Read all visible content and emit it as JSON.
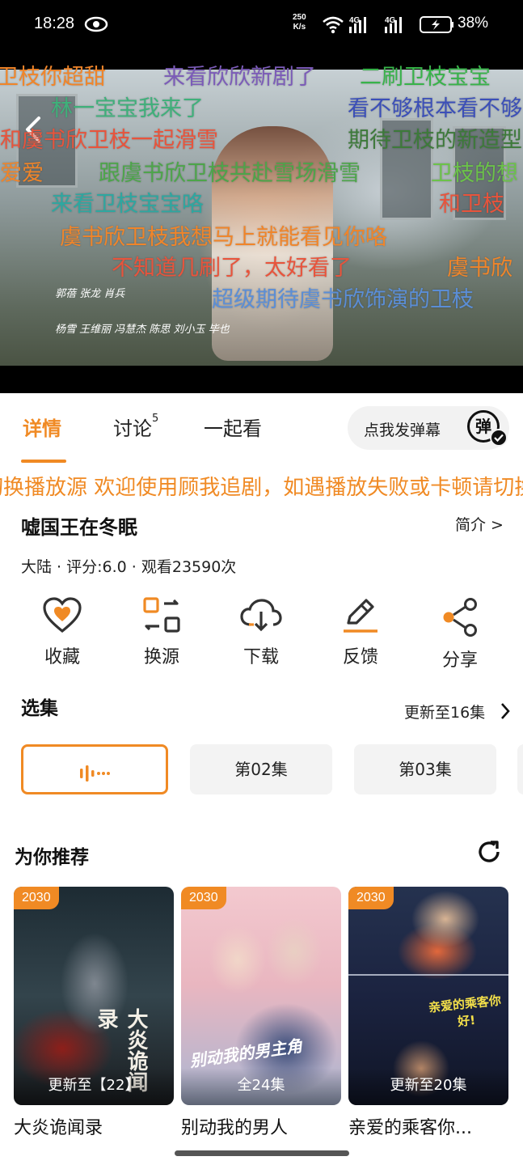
{
  "status_bar": {
    "time": "18:28",
    "net_speed_value": "250",
    "net_speed_unit": "K/s",
    "signal_label_1": "4G",
    "signal_label_2": "4G",
    "battery_percent": "38%"
  },
  "danmu": [
    {
      "text": "卫枝你超甜",
      "color": "#f0852a"
    },
    {
      "text": "来看欣欣新剧了",
      "color": "#7b5bb8"
    },
    {
      "text": "二刷卫枝宝宝",
      "color": "#38b34a"
    },
    {
      "text": "林一宝宝我来了",
      "color": "#3fb07a"
    },
    {
      "text": "看不够根本看不够",
      "color": "#3b4fb8"
    },
    {
      "text": "和虞书欣卫枝一起滑雪",
      "color": "#e8543c"
    },
    {
      "text": "期待卫枝的新造型",
      "color": "#3d7a3a"
    },
    {
      "text": "爱爱",
      "color": "#f0852a"
    },
    {
      "text": "跟虞书欣卫枝共赴雪场滑雪",
      "color": "#4da54a"
    },
    {
      "text": "卫枝的想",
      "color": "#6cc24a"
    },
    {
      "text": "来看卫枝宝宝咯",
      "color": "#2ea7a0"
    },
    {
      "text": "和卫枝",
      "color": "#e8543c"
    },
    {
      "text": "虞书欣卫枝我想马上就能看见你咯",
      "color": "#f0852a"
    },
    {
      "text": "不知道几刷了，太好看了",
      "color": "#e8543c"
    },
    {
      "text": "虞书欣",
      "color": "#f0852a"
    },
    {
      "text": "超级期待虞书欣饰演的卫枝",
      "color": "#5b8ed6"
    }
  ],
  "credits": {
    "line1": "郭蓓  张龙  肖兵",
    "line2": "杨雪  王维丽  冯慧杰  陈思  刘小玉  毕也"
  },
  "tabs": [
    {
      "label": "详情"
    },
    {
      "label": "讨论",
      "badge": "5"
    },
    {
      "label": "一起看"
    }
  ],
  "danmu_button": {
    "label": "点我发弹幕",
    "icon_char": "弹"
  },
  "notice": "切换播放源     欢迎使用顾我追剧，如遇播放失败或卡顿请切换播放源",
  "show": {
    "title": "嘘国王在冬眠",
    "intro_link": "简介 >",
    "meta": "大陆 · 评分:6.0 · 观看23590次"
  },
  "actions": [
    {
      "label": "收藏",
      "icon": "heart-icon"
    },
    {
      "label": "换源",
      "icon": "switch-source-icon"
    },
    {
      "label": "下载",
      "icon": "cloud-download-icon"
    },
    {
      "label": "反馈",
      "icon": "edit-icon"
    },
    {
      "label": "分享",
      "icon": "share-icon"
    }
  ],
  "episodes": {
    "section_title": "选集",
    "update_link": "更新至16集",
    "items": [
      {
        "label": "",
        "state": "playing"
      },
      {
        "label": "第02集"
      },
      {
        "label": "第03集"
      }
    ]
  },
  "recommend": {
    "section_title": "为你推荐",
    "cards": [
      {
        "year": "2030",
        "status": "更新至【22】",
        "title": "大炎诡闻录",
        "poster_text": "大炎诡闻录"
      },
      {
        "year": "2030",
        "status": "全24集",
        "title": "别动我的男人",
        "poster_text": "别动我的男主角"
      },
      {
        "year": "2030",
        "status": "更新至20集",
        "title": "亲爱的乘客你...",
        "poster_text": "亲爱的乘客你好!"
      }
    ]
  },
  "colors": {
    "accent": "#f08a24"
  }
}
